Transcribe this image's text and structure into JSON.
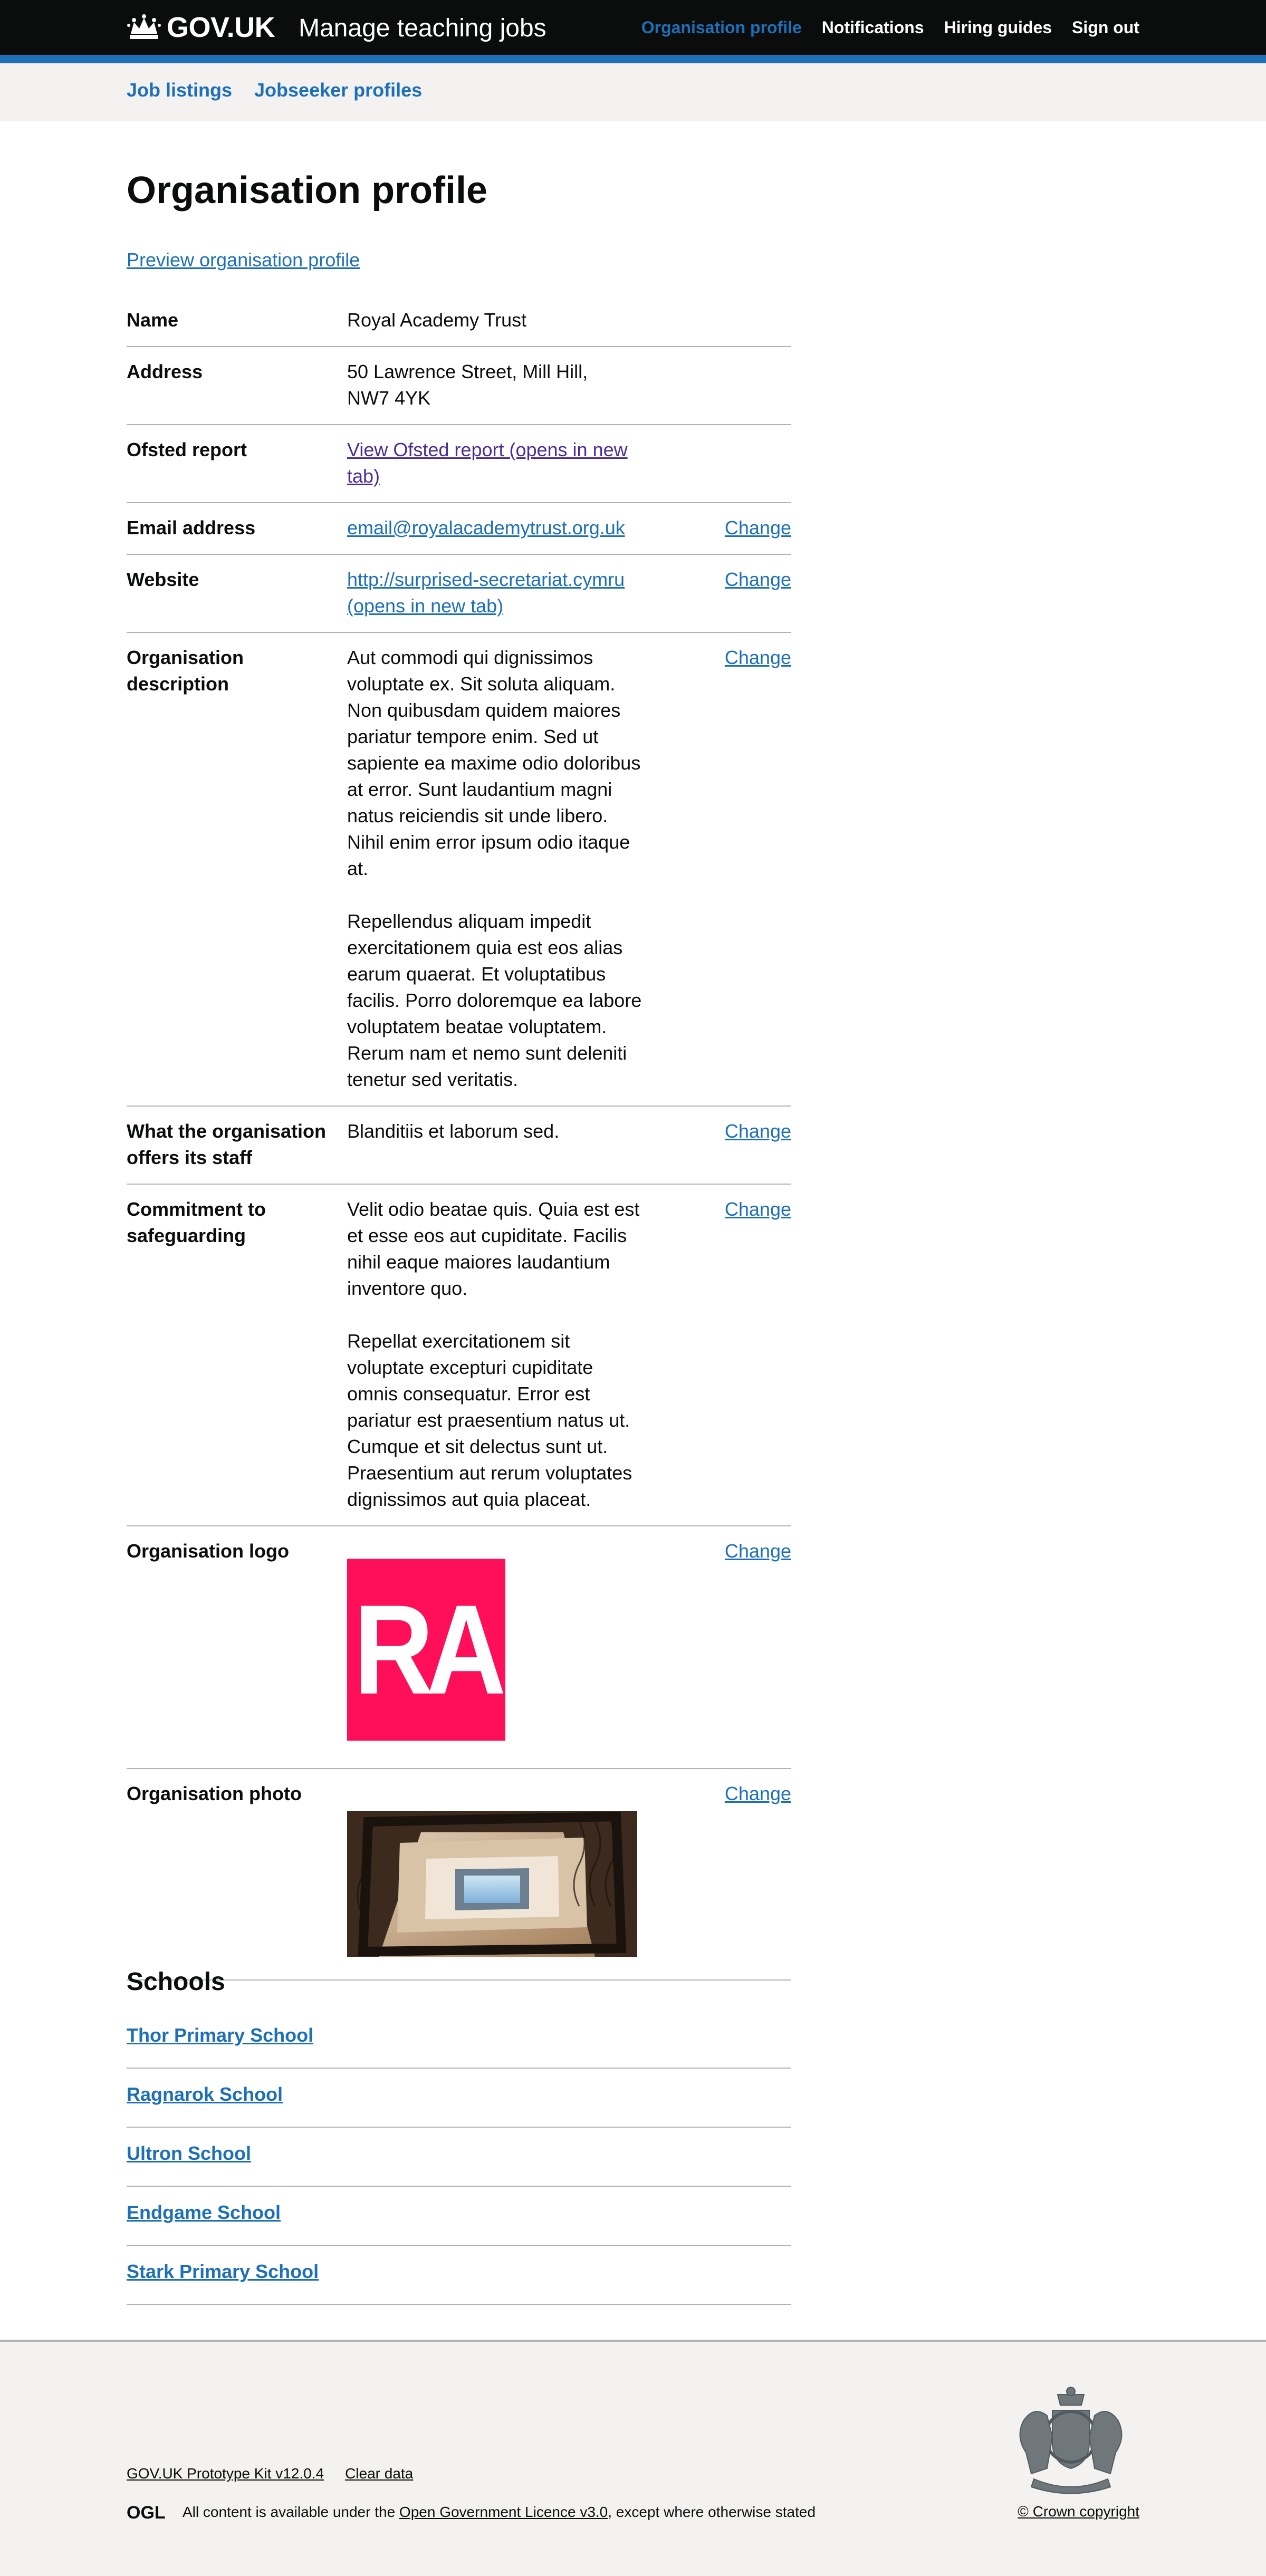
{
  "header": {
    "logo_text": "GOV.UK",
    "service_name": "Manage teaching jobs",
    "nav": [
      "Organisation profile",
      "Notifications",
      "Hiring guides",
      "Sign out"
    ],
    "active_nav": "Organisation profile",
    "colors": {
      "background": "#0b0c0c",
      "stripe": "#1d70b8",
      "link": "#1d70b8"
    }
  },
  "subnav": {
    "job_listings": "Job listings",
    "jobseeker_profiles": "Jobseeker profiles"
  },
  "main": {
    "title": "Organisation profile",
    "preview_link": "Preview organisation profile",
    "change_label": "Change",
    "summary": {
      "name": {
        "key": "Name",
        "value": "Royal Academy Trust"
      },
      "address": {
        "key": "Address",
        "value": "50 Lawrence Street, Mill Hill,\nNW7 4YK"
      },
      "ofsted": {
        "key": "Ofsted report",
        "value": "View Ofsted report (opens in new tab)"
      },
      "email": {
        "key": "Email address",
        "value": "email@royalacademytrust.org.uk"
      },
      "website": {
        "key": "Website",
        "value": "http://surprised-secretariat.cymru (opens in new tab)"
      },
      "description": {
        "key": "Organisation description",
        "value": "Aut commodi qui dignissimos voluptate ex. Sit soluta aliquam. Non quibusdam quidem maiores pariatur tempore enim. Sed ut sapiente ea maxime odio doloribus at error. Sunt laudantium magni natus reiciendis sit unde libero. Nihil enim error ipsum odio itaque at.\n\nRepellendus aliquam impedit exercitationem quia est eos alias earum quaerat. Et voluptatibus facilis. Porro doloremque ea labore voluptatem beatae voluptatem. Rerum nam et nemo sunt deleniti tenetur sed veritatis."
      },
      "offers": {
        "key": "What the organisation offers its staff",
        "value": "Blanditiis et laborum sed."
      },
      "safeguarding": {
        "key": "Commitment to safeguarding",
        "value": "Velit odio beatae quis. Quia est est et esse eos aut cupiditate. Facilis nihil eaque maiores laudantium inventore quo.\n\nRepellat exercitationem sit voluptate excepturi cupiditate omnis consequatur. Error est pariatur est praesentium natus ut. Cumque et sit delectus sunt ut. Praesentium aut rerum voluptates dignissimos aut quia placeat."
      },
      "logo": {
        "key": "Organisation logo",
        "image_text": "RA",
        "color": "#ff0f5a"
      },
      "photo": {
        "key": "Organisation photo"
      }
    },
    "schools_title": "Schools",
    "schools": [
      "Thor Primary School",
      "Ragnarok School",
      "Ultron School",
      "Endgame School",
      "Stark Primary School"
    ]
  },
  "footer": {
    "prototype_kit": "GOV.UK Prototype Kit v12.0.4",
    "clear_data": "Clear data",
    "licence_prefix": "All content is available under the ",
    "licence_link": "Open Government Licence v3.0",
    "licence_suffix": ", except where otherwise stated",
    "copyright": "© Crown copyright"
  }
}
